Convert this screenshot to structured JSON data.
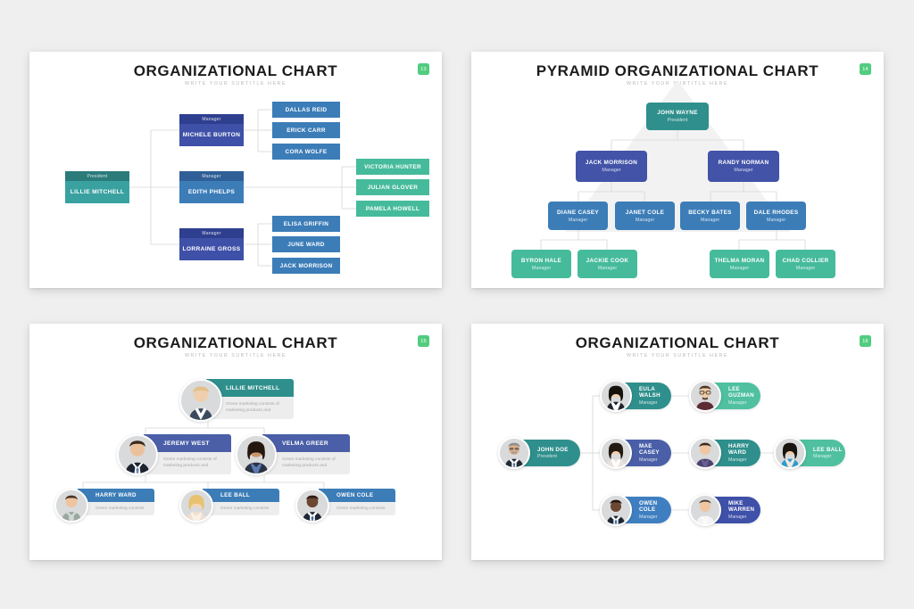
{
  "deck": {
    "background_color": "#efefef",
    "slide_background": "#ffffff",
    "badge_color": "#52cc80",
    "palette": {
      "teal_dark": "#2b8080",
      "teal": "#2f8f8c",
      "teal_light": "#3aa1a1",
      "green": "#46bb9b",
      "green_light": "#4fc0a0",
      "blue": "#3c7db8",
      "blue_mid": "#3f7fc1",
      "indigo": "#3f50a8",
      "indigo_dark": "#3a4a9e",
      "navy_header": "#2f3f8f",
      "line_color": "#d6d6d6",
      "desc_bg": "#ededed",
      "desc_text": "#a7a7a7",
      "subtitle": "#b9b9b9"
    }
  },
  "slides": [
    {
      "id": "slide1",
      "title": "ORGANIZATIONAL CHART",
      "subtitle": "WRITE YOUR SUBTITLE HERE",
      "page": "13",
      "type": "rectangular-org-chart",
      "nodes": [
        {
          "name": "LILLIE MITCHELL",
          "role": "President"
        },
        {
          "name": "MICHELE BURTON",
          "role": "Manager"
        },
        {
          "name": "EDITH PHELPS",
          "role": "Manager"
        },
        {
          "name": "LORRAINE GROSS",
          "role": "Manager"
        },
        {
          "name": "DALLAS REID",
          "role": ""
        },
        {
          "name": "ERICK CARR",
          "role": ""
        },
        {
          "name": "CORA WOLFE",
          "role": ""
        },
        {
          "name": "ELISA GRIFFIN",
          "role": ""
        },
        {
          "name": "JUNE WARD",
          "role": ""
        },
        {
          "name": "JACK MORRISON",
          "role": ""
        },
        {
          "name": "VICTORIA HUNTER",
          "role": ""
        },
        {
          "name": "JULIAN GLOVER",
          "role": ""
        },
        {
          "name": "PAMELA HOWELL",
          "role": ""
        }
      ]
    },
    {
      "id": "slide2",
      "title": "PYRAMID ORGANIZATIONAL CHART",
      "subtitle": "WRITE YOUR SUBTITLE HERE",
      "page": "14",
      "type": "pyramid-org-chart",
      "nodes": [
        {
          "name": "JOHN WAYNE",
          "role": "President"
        },
        {
          "name": "JACK MORRISON",
          "role": "Manager"
        },
        {
          "name": "RANDY NORMAN",
          "role": "Manager"
        },
        {
          "name": "DIANE CASEY",
          "role": "Manager"
        },
        {
          "name": "JANET COLE",
          "role": "Manager"
        },
        {
          "name": "BECKY BATES",
          "role": "Manager"
        },
        {
          "name": "DALE RHODES",
          "role": "Manager"
        },
        {
          "name": "BYRON HALE",
          "role": "Manager"
        },
        {
          "name": "JACKIE COOK",
          "role": "Manager"
        },
        {
          "name": "THELMA MORAN",
          "role": "Manager"
        },
        {
          "name": "CHAD COLLIER",
          "role": "Manager"
        }
      ]
    },
    {
      "id": "slide3",
      "title": "ORGANIZATIONAL CHART",
      "subtitle": "WRITE YOUR SUBTITLE HERE",
      "page": "15",
      "type": "photo-card-org-chart",
      "nodes": [
        {
          "name": "LILLIE MITCHELL",
          "desc": "Green marketing consists of marketing products and"
        },
        {
          "name": "JEREMY WEST",
          "desc": "Green marketing consists of marketing products and"
        },
        {
          "name": "VELMA GREER",
          "desc": "Green marketing consists of marketing products and"
        },
        {
          "name": "HARRY WARD",
          "desc": "Green marketing consists"
        },
        {
          "name": "LEE BALL",
          "desc": "Green marketing consists"
        },
        {
          "name": "OWEN COLE",
          "desc": "Green marketing consists"
        }
      ]
    },
    {
      "id": "slide4",
      "title": "ORGANIZATIONAL CHART",
      "subtitle": "WRITE YOUR SUBTITLE HERE",
      "page": "16",
      "type": "pill-photo-org-chart",
      "nodes": [
        {
          "name": "JOHN DOE",
          "role": "President"
        },
        {
          "name": "EULA WALSH",
          "role": "Manager"
        },
        {
          "name": "LEE GUZMAN",
          "role": "Manager"
        },
        {
          "name": "MAE CASEY",
          "role": "Manager"
        },
        {
          "name": "HARRY WARD",
          "role": "Manager"
        },
        {
          "name": "LEE BALL",
          "role": "Manager"
        },
        {
          "name": "OWEN COLE",
          "role": "Manager"
        },
        {
          "name": "MIKE WARREN",
          "role": "Manager"
        }
      ]
    }
  ]
}
